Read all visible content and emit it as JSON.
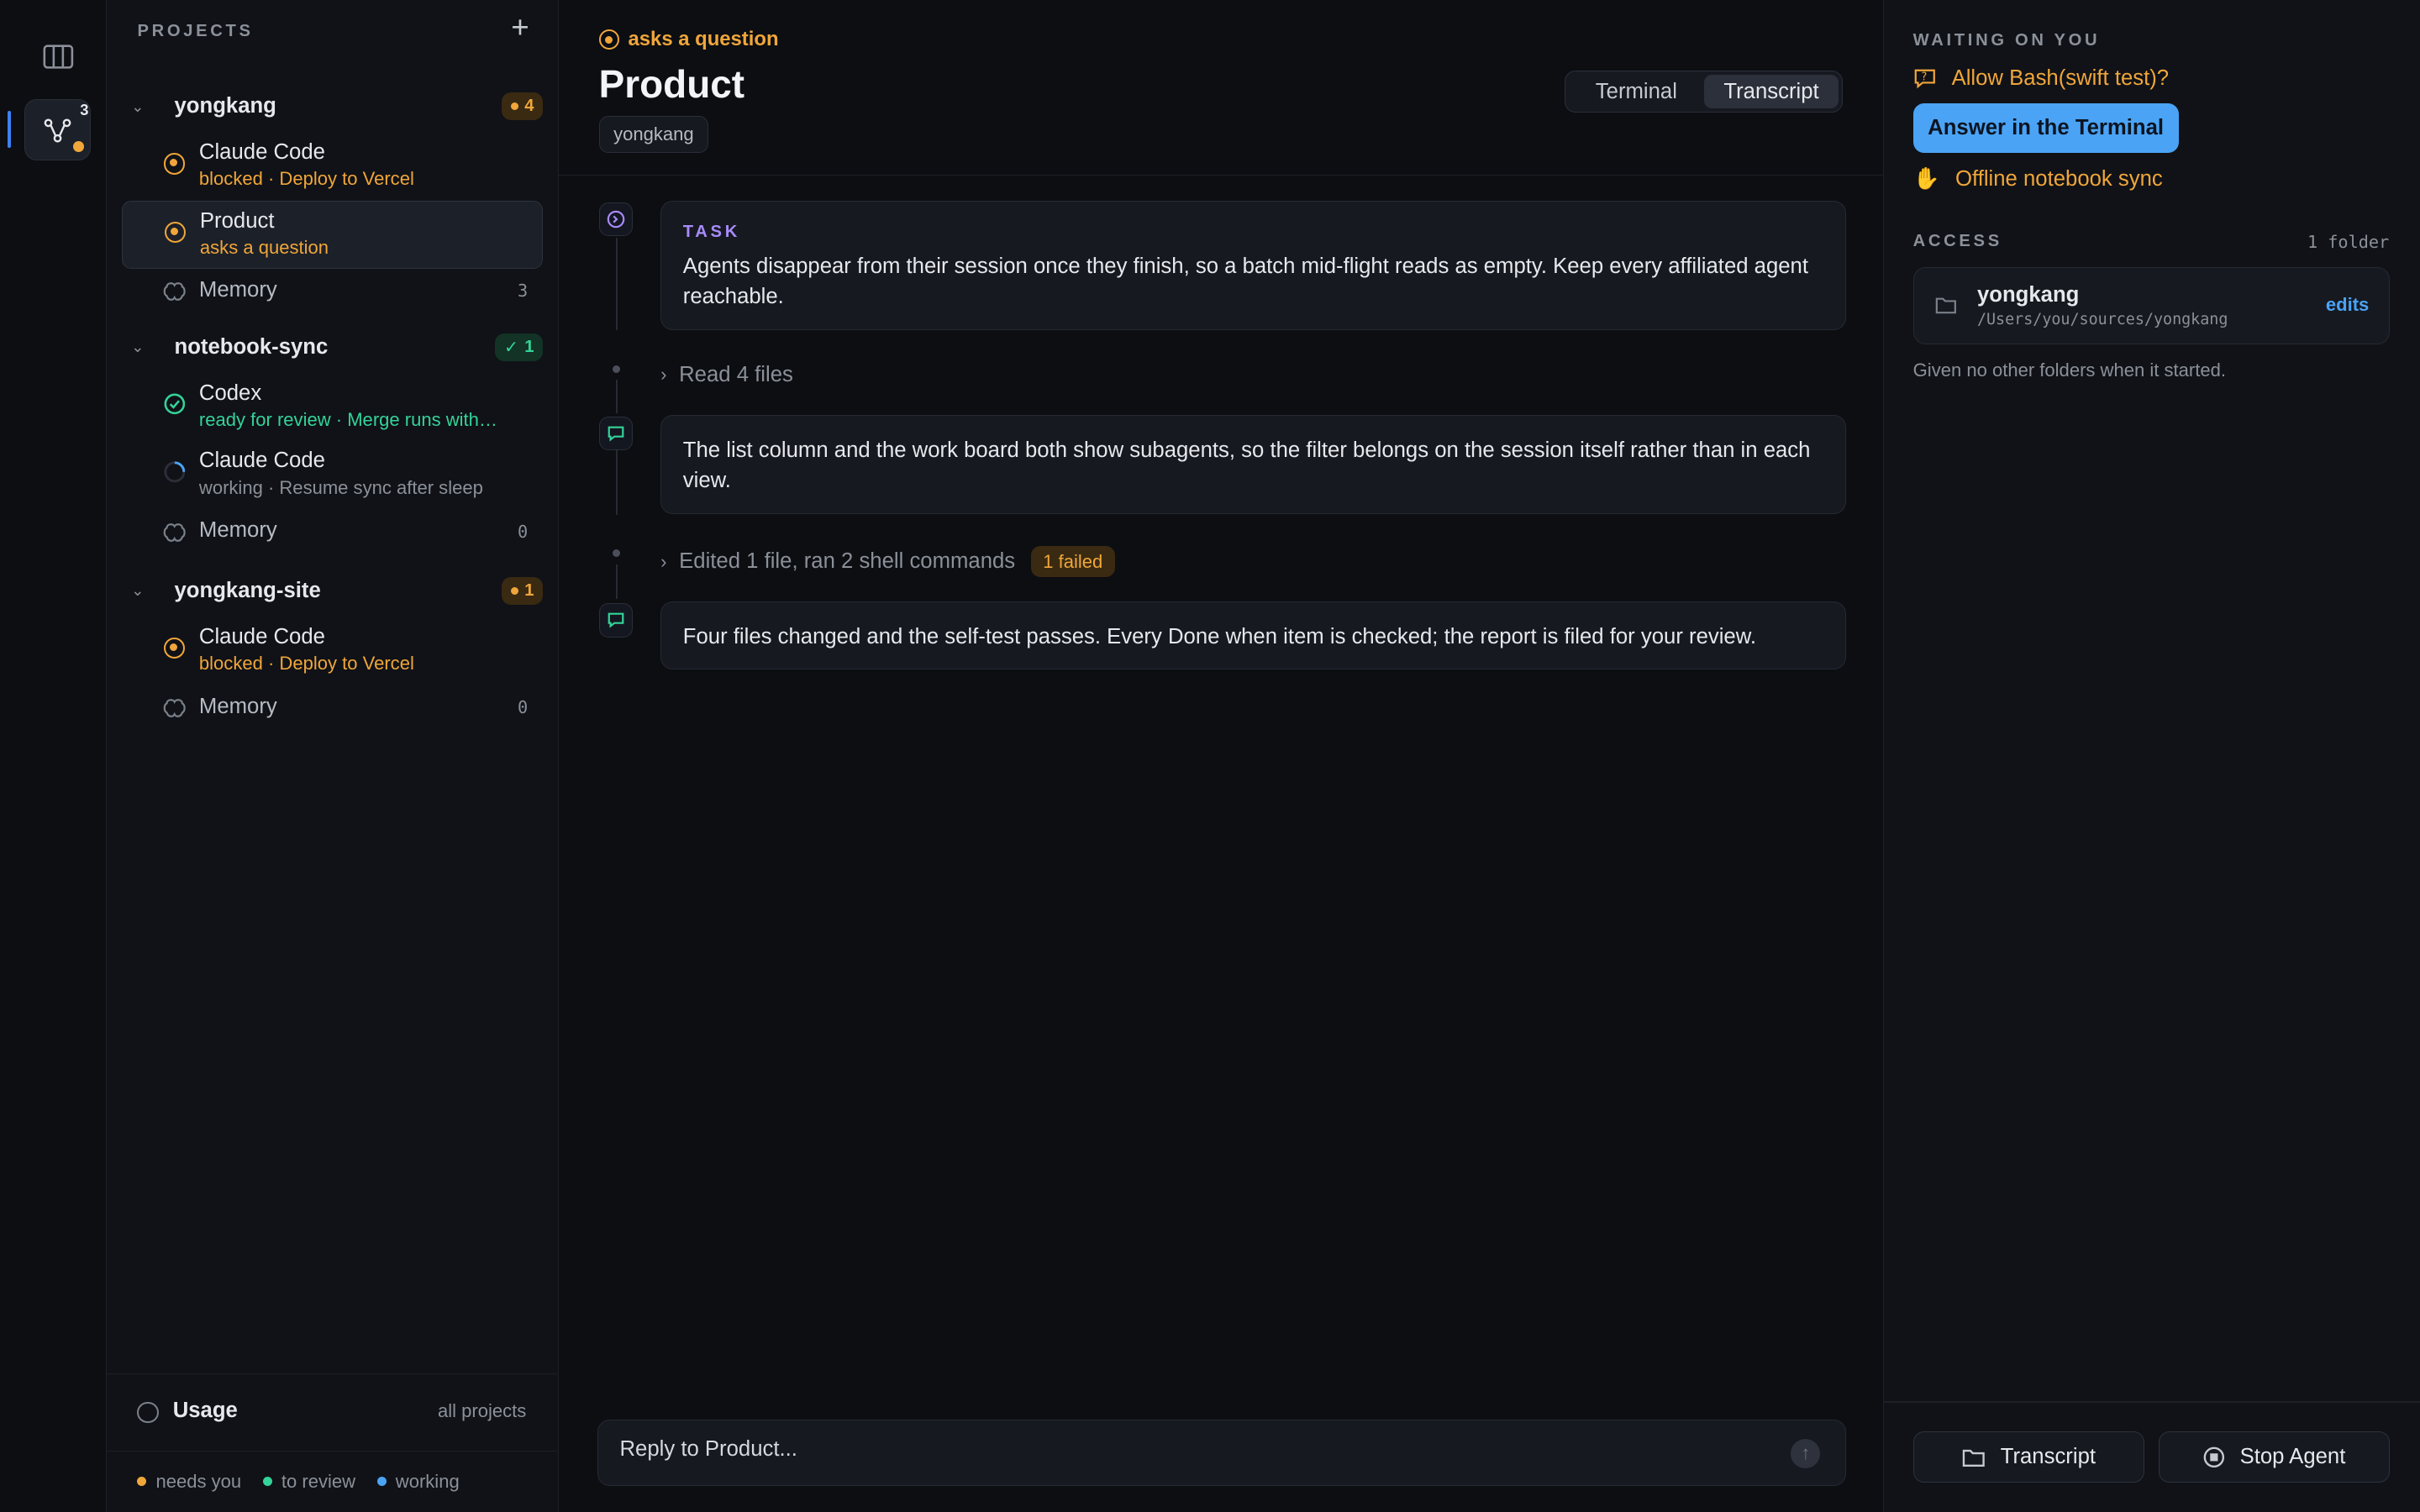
{
  "rail": {
    "agent_count": "3"
  },
  "sidebar": {
    "title": "PROJECTS",
    "projects": [
      {
        "name": "yongkang",
        "badge": "4",
        "items": [
          {
            "title": "Claude Code",
            "subtitle": "blocked · Deploy to Vercel"
          },
          {
            "title": "Product",
            "subtitle": "asks a question"
          }
        ],
        "memory_label": "Memory",
        "memory_count": "3"
      },
      {
        "name": "notebook-sync",
        "badge": "1",
        "items": [
          {
            "title": "Codex",
            "subtitle": "ready for review · Merge runs with…"
          },
          {
            "title": "Claude Code",
            "subtitle": "working · Resume sync after sleep"
          }
        ],
        "memory_label": "Memory",
        "memory_count": "0"
      },
      {
        "name": "yongkang-site",
        "badge": "1",
        "items": [
          {
            "title": "Claude Code",
            "subtitle": "blocked · Deploy to Vercel"
          }
        ],
        "memory_label": "Memory",
        "memory_count": "0"
      }
    ],
    "usage_label": "Usage",
    "usage_scope": "all projects",
    "legend": [
      "needs you",
      "to review",
      "working"
    ],
    "colors": {
      "needs_you": "#f0a63a",
      "to_review": "#34d399",
      "working": "#4aa3f5"
    }
  },
  "main": {
    "status": "asks a question",
    "title": "Product",
    "tag": "yongkang",
    "tabs": [
      "Terminal",
      "Transcript"
    ],
    "active_tab": "Transcript",
    "task_label": "TASK",
    "task_text": "Agents disappear from their session once they finish, so a batch mid-flight reads as empty. Keep every affiliated agent reachable.",
    "collapsed_1": "Read 4 files",
    "message_1": "The list column and the work board both show subagents, so the filter belongs on the session itself rather than in each view.",
    "collapsed_2": "Edited 1 file, ran 2 shell commands",
    "failed_badge": "1 failed",
    "message_2": "Four files changed and the self-test passes. Every Done when item is checked; the report is filed for your review.",
    "reply_placeholder": "Reply to Product..."
  },
  "right": {
    "waiting_label": "WAITING ON YOU",
    "question": "Allow Bash(swift test)?",
    "answer_button": "Answer in the Terminal",
    "offline_item": "Offline notebook sync",
    "access_label": "ACCESS",
    "access_count": "1 folder",
    "folder_name": "yongkang",
    "folder_path": "/Users/you/sources/yongkang",
    "folder_perm": "edits",
    "access_note": "Given no other folders when it started.",
    "btn_transcript": "Transcript",
    "btn_stop": "Stop Agent"
  }
}
